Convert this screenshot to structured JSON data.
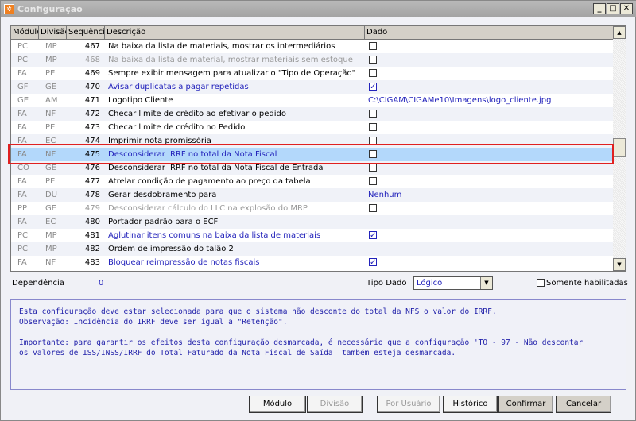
{
  "window": {
    "title": "Configuração",
    "controls": [
      "_",
      "□",
      "✕"
    ]
  },
  "grid": {
    "columns": [
      "Módulo",
      "Divisão",
      "Sequência",
      "Descrição",
      "Dado"
    ],
    "rows": [
      {
        "modulo": "PC",
        "divisao": "MP",
        "seq": "467",
        "desc": "Na baixa da lista de materiais, mostrar os intermediários",
        "dado": "unchecked",
        "style": ""
      },
      {
        "modulo": "PC",
        "divisao": "MP",
        "seq": "468",
        "desc": "Na baixa da lista de material, mostrar materiais sem estoque",
        "dado": "unchecked",
        "style": "strike"
      },
      {
        "modulo": "FA",
        "divisao": "PE",
        "seq": "469",
        "desc": "Sempre exibir mensagem para atualizar o \"Tipo de Operação\"",
        "dado": "unchecked",
        "style": ""
      },
      {
        "modulo": "GF",
        "divisao": "GE",
        "seq": "470",
        "desc": "Avisar duplicatas a pagar repetidas",
        "dado": "checked",
        "style": "blue"
      },
      {
        "modulo": "GE",
        "divisao": "AM",
        "seq": "471",
        "desc": "Logotipo Cliente",
        "dado": "C:\\CIGAM\\CIGAMe10\\Imagens\\logo_cliente.jpg",
        "style": ""
      },
      {
        "modulo": "FA",
        "divisao": "NF",
        "seq": "472",
        "desc": "Checar limite de crédito ao efetivar o pedido",
        "dado": "unchecked",
        "style": ""
      },
      {
        "modulo": "FA",
        "divisao": "PE",
        "seq": "473",
        "desc": "Checar limite de crédito no Pedido",
        "dado": "unchecked",
        "style": ""
      },
      {
        "modulo": "FA",
        "divisao": "EC",
        "seq": "474",
        "desc": "Imprimir nota promissória",
        "dado": "unchecked",
        "style": ""
      },
      {
        "modulo": "FA",
        "divisao": "NF",
        "seq": "475",
        "desc": "Desconsiderar IRRF no total da Nota Fiscal",
        "dado": "unchecked",
        "style": "sel"
      },
      {
        "modulo": "CO",
        "divisao": "GE",
        "seq": "476",
        "desc": "Desconsiderar IRRF no total da Nota Fiscal de Entrada",
        "dado": "unchecked",
        "style": ""
      },
      {
        "modulo": "FA",
        "divisao": "PE",
        "seq": "477",
        "desc": "Atrelar condição de pagamento ao preço da tabela",
        "dado": "unchecked",
        "style": ""
      },
      {
        "modulo": "FA",
        "divisao": "DU",
        "seq": "478",
        "desc": "Gerar desdobramento para",
        "dado": "Nenhum",
        "style": ""
      },
      {
        "modulo": "PP",
        "divisao": "GE",
        "seq": "479",
        "desc": "Desconsiderar cálculo do LLC na explosão do MRP",
        "dado": "unchecked",
        "style": "dis"
      },
      {
        "modulo": "FA",
        "divisao": "EC",
        "seq": "480",
        "desc": "Portador padrão para o ECF",
        "dado": "",
        "style": ""
      },
      {
        "modulo": "PC",
        "divisao": "MP",
        "seq": "481",
        "desc": "Aglutinar itens comuns na baixa da lista de materiais",
        "dado": "checked",
        "style": "blue"
      },
      {
        "modulo": "PC",
        "divisao": "MP",
        "seq": "482",
        "desc": "Ordem de impressão do talão 2",
        "dado": "",
        "style": ""
      },
      {
        "modulo": "FA",
        "divisao": "NF",
        "seq": "483",
        "desc": "Bloquear reimpressão de notas fiscais",
        "dado": "checked",
        "style": "blue"
      }
    ]
  },
  "dependencia": {
    "label": "Dependência",
    "value": "0"
  },
  "tipo_dado": {
    "label": "Tipo Dado",
    "value": "Lógico"
  },
  "somente_habilitadas": {
    "label": "Somente habilitadas",
    "checked": false
  },
  "description": "Esta configuração deve estar selecionada para que o sistema não desconte do total da NFS o valor do IRRF.\nObservação: Incidência do IRRF deve ser igual a \"Retenção\".\n\nImportante: para garantir os efeitos desta configuração desmarcada, é necessário que a configuração 'TO - 97 - Não descontar\nos valores de ISS/INSS/IRRF do Total Faturado da Nota Fiscal de Saída' também esteja desmarcada.",
  "buttons": {
    "modulo": "Módulo",
    "divisao": "Divisão",
    "por_usuario": "Por Usuário",
    "historico": "Histórico",
    "confirmar": "Confirmar",
    "cancelar": "Cancelar"
  }
}
